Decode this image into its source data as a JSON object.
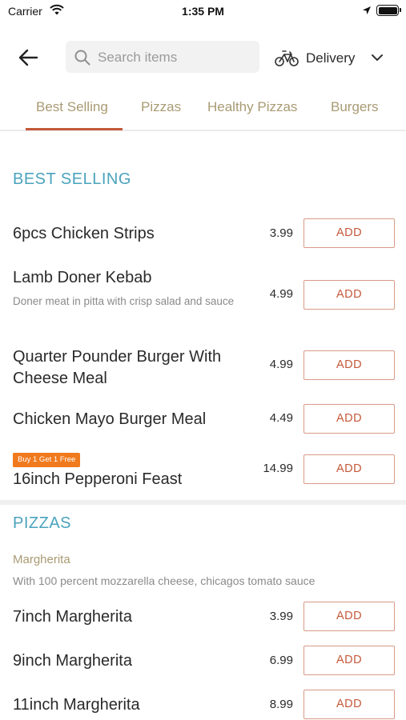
{
  "status_bar": {
    "carrier": "Carrier",
    "time": "1:35 PM",
    "icons": [
      "wifi-icon",
      "location-arrow-icon",
      "battery-icon"
    ]
  },
  "header": {
    "back_icon": "arrow-left-icon",
    "search": {
      "placeholder": "Search items",
      "value": ""
    },
    "delivery": {
      "label": "Delivery",
      "icon": "bicycle-icon"
    }
  },
  "tabs": [
    {
      "label": "Best Selling",
      "active": true
    },
    {
      "label": "Pizzas",
      "active": false
    },
    {
      "label": "Healthy Pizzas",
      "active": false
    },
    {
      "label": "Burgers",
      "active": false
    }
  ],
  "colors": {
    "accent": "#c4593a",
    "section_title": "#4aa3bd",
    "tab_text": "#a89a73",
    "promo_badge": "#f07a1e"
  },
  "sections": {
    "best_selling": {
      "title": "BEST SELLING",
      "items": [
        {
          "name": "6pcs Chicken Strips",
          "price": "3.99",
          "button": "ADD"
        },
        {
          "name": "Lamb Doner Kebab",
          "description": "Doner meat in pitta with crisp salad and sauce",
          "price": "4.99",
          "button": "ADD"
        },
        {
          "name": "Quarter Pounder Burger With Cheese Meal",
          "price": "4.99",
          "button": "ADD"
        },
        {
          "name": "Chicken Mayo Burger Meal",
          "price": "4.49",
          "button": "ADD"
        },
        {
          "name": "16inch Pepperoni Feast",
          "badge": "Buy 1 Get 1 Free",
          "price": "14.99",
          "button": "ADD"
        }
      ]
    },
    "pizzas": {
      "title": "PIZZAS",
      "group": {
        "title": "Margherita",
        "description": "With 100 percent mozzarella cheese, chicagos tomato sauce"
      },
      "items": [
        {
          "name": "7inch Margherita",
          "price": "3.99",
          "button": "ADD"
        },
        {
          "name": "9inch Margherita",
          "price": "6.99",
          "button": "ADD"
        },
        {
          "name": "11inch Margherita",
          "price": "8.99",
          "button": "ADD"
        }
      ]
    }
  }
}
